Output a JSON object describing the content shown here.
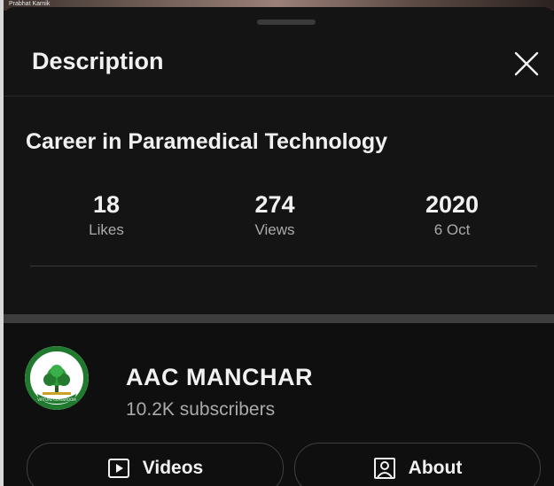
{
  "video_strip": {
    "label": "Prabhat Karnik"
  },
  "panel": {
    "title": "Description"
  },
  "video": {
    "title": "Career in Paramedical Technology",
    "stats": [
      {
        "value": "18",
        "label": "Likes"
      },
      {
        "value": "274",
        "label": "Views"
      },
      {
        "value": "2020",
        "label": "6 Oct"
      }
    ]
  },
  "channel": {
    "name": "AAC MANCHAR",
    "subscribers": "10.2K subscribers",
    "logo_text": "VIRTUAL CLASSROOM",
    "buttons": {
      "videos": "Videos",
      "about": "About"
    }
  },
  "colors": {
    "background": "#0f0f0f",
    "sheet": "#141414",
    "text_primary": "#f1f1f1",
    "text_secondary": "#aaaaaa",
    "logo_green": "#1f7a2e"
  }
}
